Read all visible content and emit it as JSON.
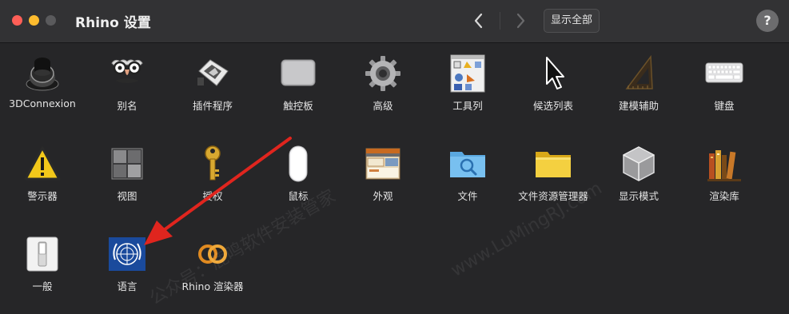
{
  "window": {
    "title": "Rhino 设置",
    "show_all_label": "显示全部",
    "help_label": "?"
  },
  "icons": {
    "back": "chevron-left-icon",
    "forward": "chevron-right-icon"
  },
  "watermarks": [
    "公众号：鹿鸣软件安装管家",
    "www.LuMingRJ.com"
  ],
  "rows": [
    [
      {
        "label": "3DConnexion",
        "icon": "3dconnexion-icon"
      },
      {
        "label": "别名",
        "icon": "alias-icon"
      },
      {
        "label": "插件程序",
        "icon": "plugin-icon"
      },
      {
        "label": "触控板",
        "icon": "trackpad-icon"
      },
      {
        "label": "高级",
        "icon": "gear-icon"
      },
      {
        "label": "工具列",
        "icon": "toolbar-icon"
      },
      {
        "label": "候选列表",
        "icon": "cursor-icon"
      },
      {
        "label": "建模辅助",
        "icon": "triangle-ruler-icon"
      },
      {
        "label": "键盘",
        "icon": "keyboard-icon"
      }
    ],
    [
      {
        "label": "警示器",
        "icon": "warning-icon"
      },
      {
        "label": "视图",
        "icon": "viewports-icon"
      },
      {
        "label": "授权",
        "icon": "key-icon"
      },
      {
        "label": "鼠标",
        "icon": "mouse-icon"
      },
      {
        "label": "外观",
        "icon": "appearance-icon"
      },
      {
        "label": "文件",
        "icon": "folder-search-icon"
      },
      {
        "label": "文件资源管理器",
        "icon": "folder-icon"
      },
      {
        "label": "显示模式",
        "icon": "display-cube-icon"
      },
      {
        "label": "渲染库",
        "icon": "books-icon"
      }
    ],
    [
      {
        "label": "一般",
        "icon": "switch-icon"
      },
      {
        "label": "语言",
        "icon": "un-flag-icon"
      },
      {
        "label": "Rhino 渲染器",
        "icon": "render-rings-icon"
      }
    ]
  ]
}
